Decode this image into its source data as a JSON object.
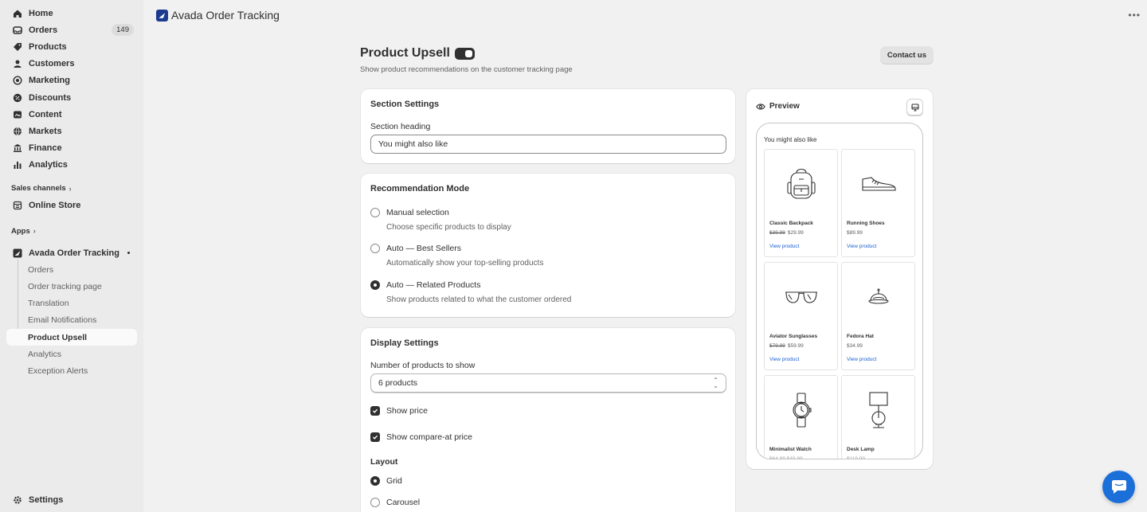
{
  "sidebar": {
    "items": [
      {
        "label": "Home",
        "icon": "home-icon"
      },
      {
        "label": "Orders",
        "icon": "orders-icon",
        "badge": "149"
      },
      {
        "label": "Products",
        "icon": "tag-icon"
      },
      {
        "label": "Customers",
        "icon": "person-icon"
      },
      {
        "label": "Marketing",
        "icon": "target-icon"
      },
      {
        "label": "Discounts",
        "icon": "discount-icon"
      },
      {
        "label": "Content",
        "icon": "content-icon"
      },
      {
        "label": "Markets",
        "icon": "globe-icon"
      },
      {
        "label": "Finance",
        "icon": "bank-icon"
      },
      {
        "label": "Analytics",
        "icon": "bar-chart-icon"
      }
    ],
    "sales_channels_label": "Sales channels",
    "online_store_label": "Online Store",
    "apps_label": "Apps",
    "app_name": "Avada Order Tracking",
    "app_sub_items": [
      "Orders",
      "Order tracking page",
      "Translation",
      "Email Notifications",
      "Product Upsell",
      "Analytics",
      "Exception Alerts"
    ],
    "active_sub_item": "Product Upsell",
    "settings_label": "Settings"
  },
  "topbar": {
    "app_title": "Avada Order Tracking"
  },
  "page": {
    "title": "Product Upsell",
    "subtitle": "Show product recommendations on the customer tracking page",
    "contact_label": "Contact us",
    "enabled": true
  },
  "section_settings": {
    "title": "Section Settings",
    "heading_label": "Section heading",
    "heading_value": "You might also like"
  },
  "recommendation_mode": {
    "title": "Recommendation Mode",
    "options": [
      {
        "label": "Manual selection",
        "help": "Choose specific products to display",
        "selected": false
      },
      {
        "label": "Auto — Best Sellers",
        "help": "Automatically show your top-selling products",
        "selected": false
      },
      {
        "label": "Auto — Related Products",
        "help": "Show products related to what the customer ordered",
        "selected": true
      }
    ]
  },
  "display_settings": {
    "title": "Display Settings",
    "count_label": "Number of products to show",
    "count_value": "6 products",
    "show_price_label": "Show price",
    "show_compare_label": "Show compare-at price",
    "layout_label": "Layout",
    "layout_options": [
      {
        "label": "Grid",
        "selected": true
      },
      {
        "label": "Carousel",
        "selected": false
      }
    ]
  },
  "preview": {
    "title": "Preview",
    "section_heading": "You might also like",
    "products": [
      {
        "name": "Classic Backpack",
        "compare_price": "$39.99",
        "price": "$29.99",
        "link": "View product",
        "icon": "backpack-icon"
      },
      {
        "name": "Running Shoes",
        "compare_price": "",
        "price": "$89.99",
        "link": "View product",
        "icon": "shoe-icon"
      },
      {
        "name": "Aviator Sunglasses",
        "compare_price": "$79.99",
        "price": "$59.99",
        "link": "View product",
        "icon": "sunglasses-icon"
      },
      {
        "name": "Fedora Hat",
        "compare_price": "",
        "price": "$34.99",
        "link": "View product",
        "icon": "hat-icon"
      },
      {
        "name": "Minimalist Watch",
        "compare_price": "",
        "price": "",
        "link": "",
        "icon": "watch-icon"
      },
      {
        "name": "Desk Lamp",
        "compare_price": "",
        "price": "",
        "link": "",
        "icon": "lamp-icon"
      }
    ]
  },
  "colors": {
    "accent_dark": "#303030",
    "link_blue": "#1a5fd1",
    "chat_blue": "#1b6fd8",
    "app_logo": "#1d3b8f"
  }
}
